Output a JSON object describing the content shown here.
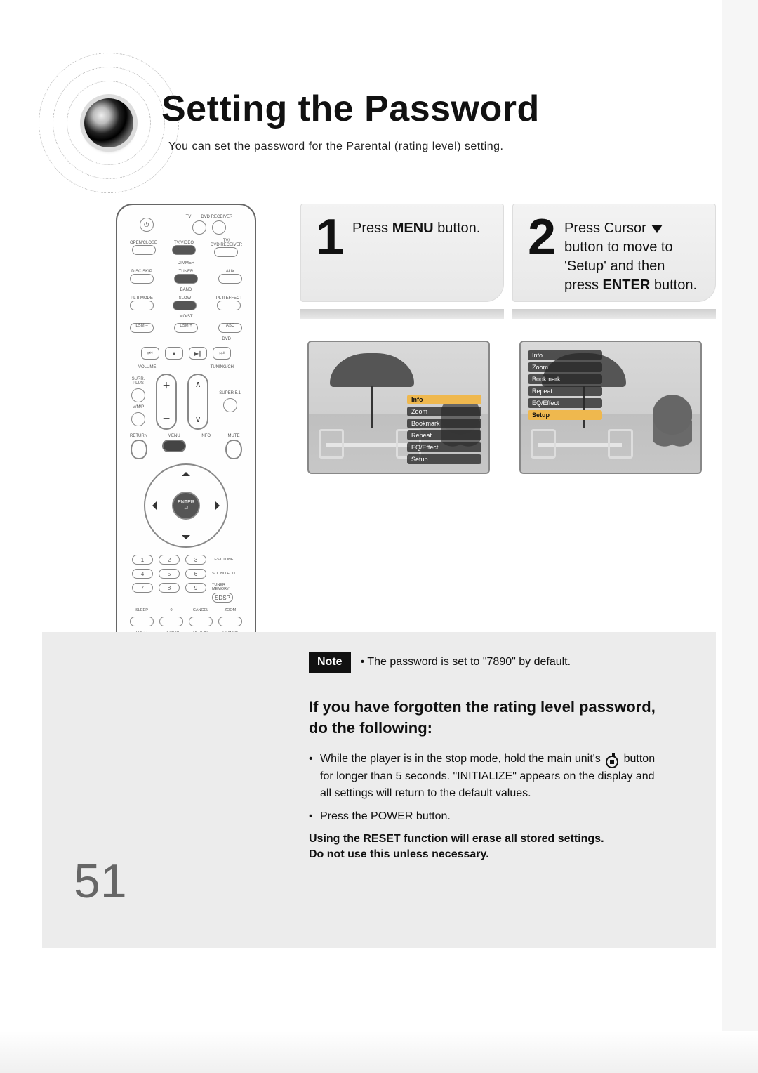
{
  "header": {
    "title": "Setting the Password",
    "subtitle": "You can set the password for the Parental (rating level) setting."
  },
  "steps": {
    "one": {
      "number": "1",
      "text_before": "Press ",
      "text_bold": "MENU",
      "text_after": " button."
    },
    "two": {
      "number": "2",
      "line1_before": "Press Cursor ",
      "line2": "button to move to",
      "line3": "'Setup' and then",
      "line4_before": "press ",
      "line4_bold": "ENTER",
      "line4_after": " button."
    }
  },
  "tv_menu": {
    "items": [
      "Info",
      "Zoom",
      "Bookmark",
      "Repeat",
      "EQ/Effect",
      "Setup"
    ],
    "highlight_one": "Info",
    "highlight_two": "Setup"
  },
  "note": {
    "badge": "Note",
    "text": "The password is set to \"7890\" by default."
  },
  "forgot": {
    "heading": "If you have forgotten the rating level password, do the following:",
    "bullet1_a": "While the player is in the stop mode, hold the main unit's ",
    "bullet1_b": " button for longer than 5 seconds. \"INITIALIZE\" appears on the display and all settings will return to the default values.",
    "bullet2": "Press the POWER button.",
    "warn1": "Using the RESET function will erase all stored settings.",
    "warn2": "Do not use this unless necessary."
  },
  "remote": {
    "top_labels": {
      "tv": "TV",
      "dvd_receiver": "DVD RECEIVER"
    },
    "row2": {
      "open_close": "OPEN/CLOSE",
      "tv_video": "TV/VIDEO",
      "tv_dvd": "TV/\nDVD RECEIVER",
      "dimmer": "DIMMER"
    },
    "row3": {
      "disc_skip": "DISC SKIP",
      "tuner": "TUNER",
      "aux": "AUX",
      "band": "BAND"
    },
    "row4": {
      "pl_mode": "PL II MODE",
      "slow": "SLOW",
      "pl_effect": "PL II EFFECT",
      "mo_st": "MO/ST"
    },
    "row5": {
      "lsm_minus": "LSM –",
      "lsm_plus": "LSM +",
      "asc": "ASC"
    },
    "dvd_label": "DVD",
    "transport_labels": {
      "volume": "VOLUME",
      "tuning": "TUNING/CH"
    },
    "side": {
      "surr_plus": "SURR.\nPLUS",
      "super51": "SUPER 5.1",
      "vmp": "V/M/P"
    },
    "menu_row": {
      "return": "RETURN",
      "menu": "MENU",
      "info": "INFO",
      "mute": "MUTE"
    },
    "enter": "ENTER",
    "num_side": {
      "test_tone": "TEST TONE",
      "sound_edit": "SOUND EDIT",
      "tuner_memory": "TUNER MEMORY",
      "sdsp": "SDSP"
    },
    "bottom": {
      "sleep": "SLEEP",
      "zero": "0",
      "cancel": "CANCEL",
      "zoom": "ZOOM",
      "logo": "LOGO",
      "ez_view": "EZ VIEW",
      "repeat": "REPEAT",
      "remain": "REMAIN"
    }
  },
  "page_number": "51"
}
